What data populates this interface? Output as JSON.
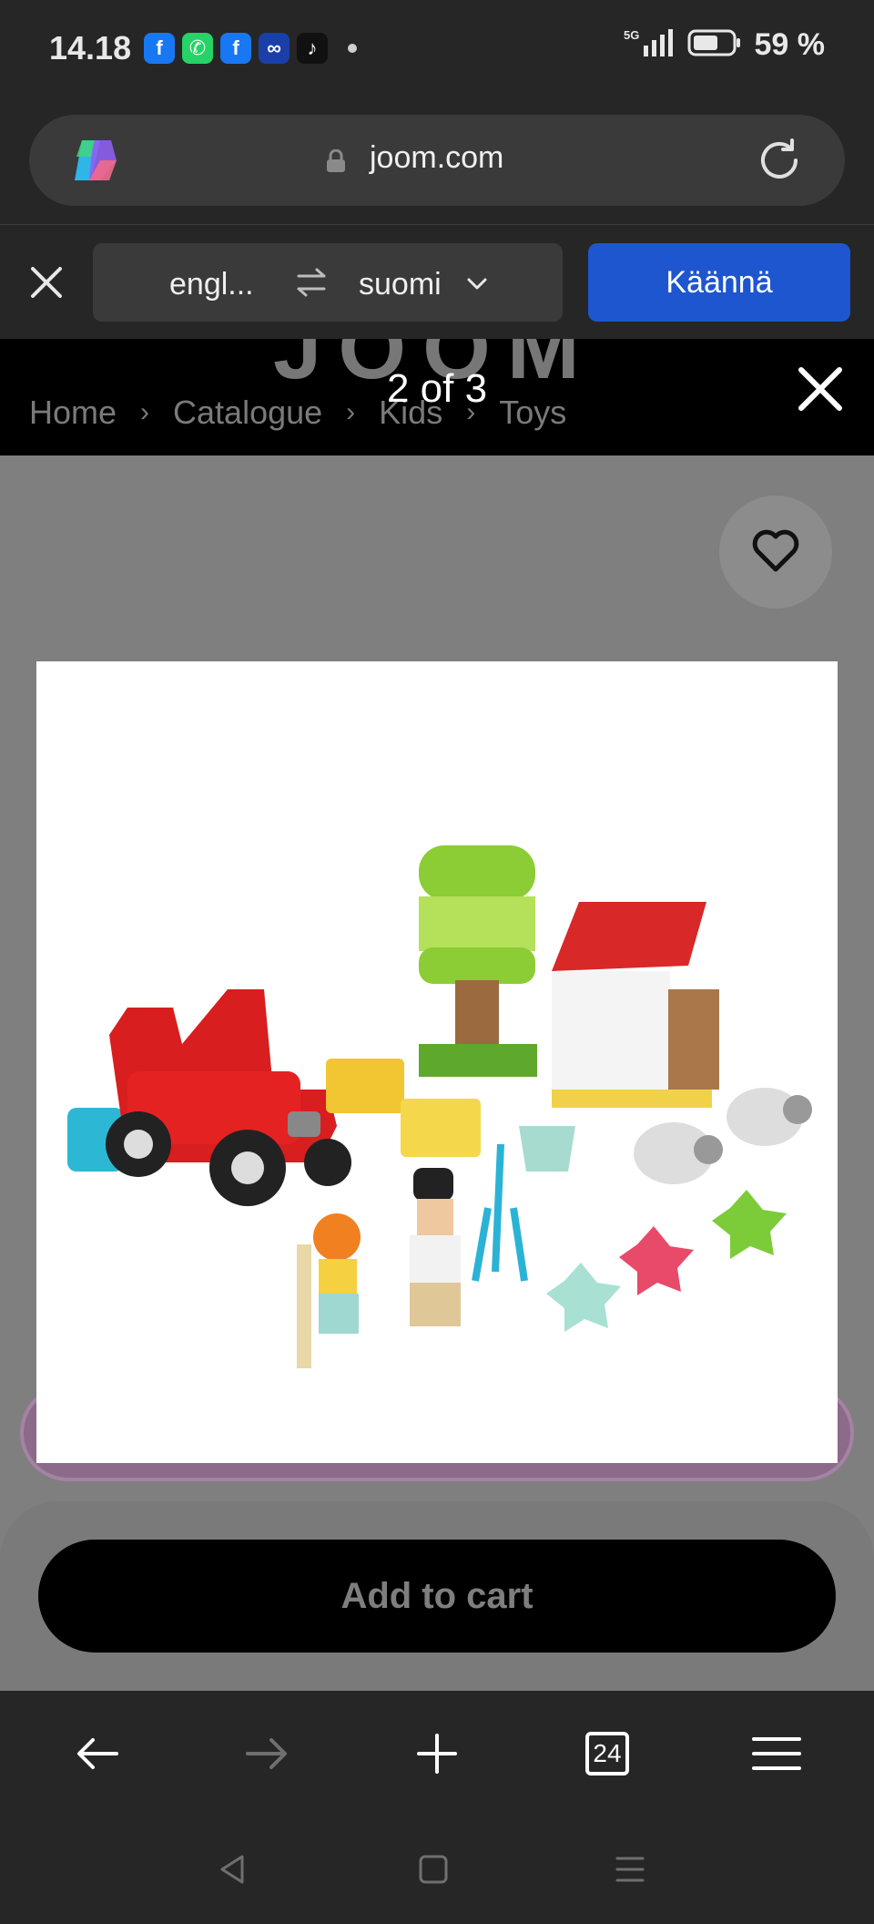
{
  "status_bar": {
    "time": "14.18",
    "notifications": [
      {
        "name": "facebook-icon",
        "glyph": "f",
        "color": "#1877f2"
      },
      {
        "name": "whatsapp-icon",
        "glyph": "✆",
        "color": "#25d366"
      },
      {
        "name": "facebook-icon",
        "glyph": "f",
        "color": "#1877f2"
      },
      {
        "name": "messenger-app-icon",
        "glyph": "∞",
        "color": "#1a3fa8"
      },
      {
        "name": "tiktok-icon",
        "glyph": "♪",
        "color": "#111111"
      }
    ],
    "network": "5G",
    "battery": "59 %"
  },
  "browser": {
    "url": "joom.com",
    "tab_count": "24"
  },
  "translate_bar": {
    "from_lang": "engl...",
    "to_lang": "suomi",
    "translate_label": "Käännä",
    "accent": "#1e56d0"
  },
  "page": {
    "breadcrumb": [
      "Home",
      "Catalogue",
      "Kids",
      "Toys"
    ],
    "add_to_cart_label": "Add to cart"
  },
  "image_viewer": {
    "counter": "2 of 3",
    "image_subject": "toy farm set with tractor, tree, shed, sheep and figures"
  }
}
